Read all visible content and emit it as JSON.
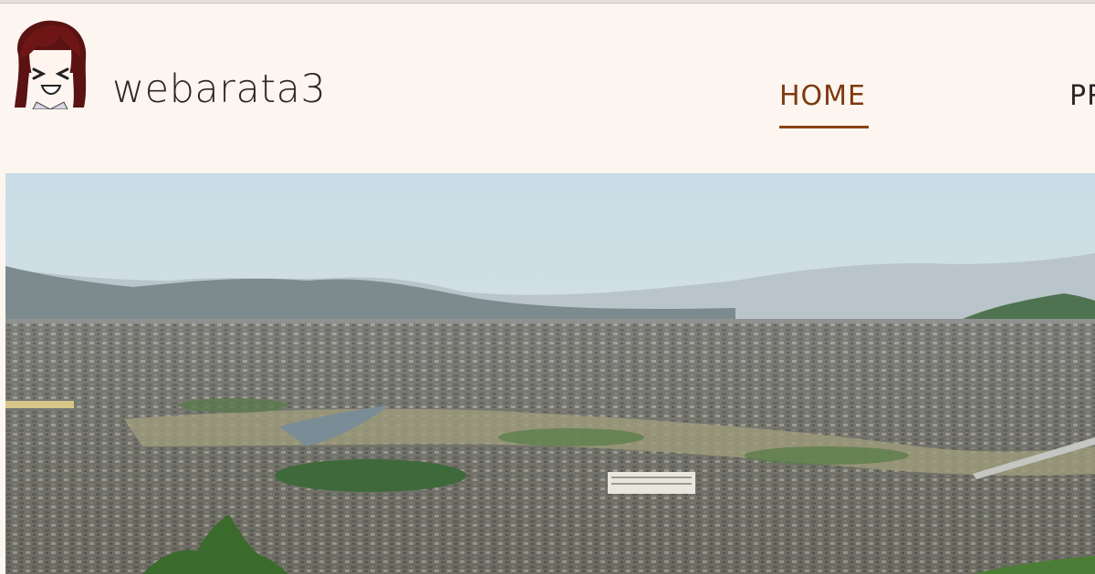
{
  "site": {
    "title": "webarata3",
    "logo_icon": "anime-girl-avatar-icon"
  },
  "nav": {
    "items": [
      {
        "label": "HOME",
        "active": true
      },
      {
        "label": "PR",
        "active": false
      }
    ],
    "active_color": "#7d3a10"
  },
  "hero": {
    "subject": "panoramic-town-landscape-photo"
  },
  "colors": {
    "background": "#fdf5f0",
    "title_text": "#2c2626",
    "accent": "#8b4213"
  }
}
